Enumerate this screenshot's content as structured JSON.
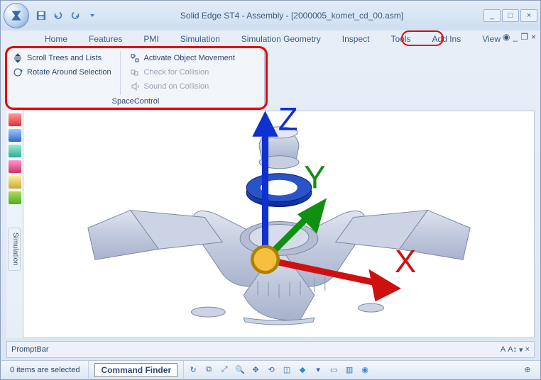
{
  "window_title": "Solid Edge ST4 - Assembly - [2000005_komet_cd_00.asm]",
  "tabs": {
    "home": "Home",
    "features": "Features",
    "pmi": "PMI",
    "simulation": "Simulation",
    "simulation_geometry": "Simulation Geometry",
    "inspect": "Inspect",
    "tools": "Tools",
    "add_ins": "Add Ins",
    "view": "View"
  },
  "ribbon": {
    "group_label": "SpaceControl",
    "scroll_trees": "Scroll Trees and Lists",
    "rotate_around": "Rotate Around Selection",
    "activate_object": "Activate Object Movement",
    "check_collision": "Check for Collision",
    "sound_collision": "Sound on Collision"
  },
  "side_panel": {
    "simulation": "Simulation"
  },
  "axis": {
    "x": "X",
    "y": "Y",
    "z": "Z"
  },
  "promptbar": {
    "label": "PromptBar"
  },
  "statusbar": {
    "selection": "0 items are selected",
    "command_finder": "Command Finder"
  }
}
